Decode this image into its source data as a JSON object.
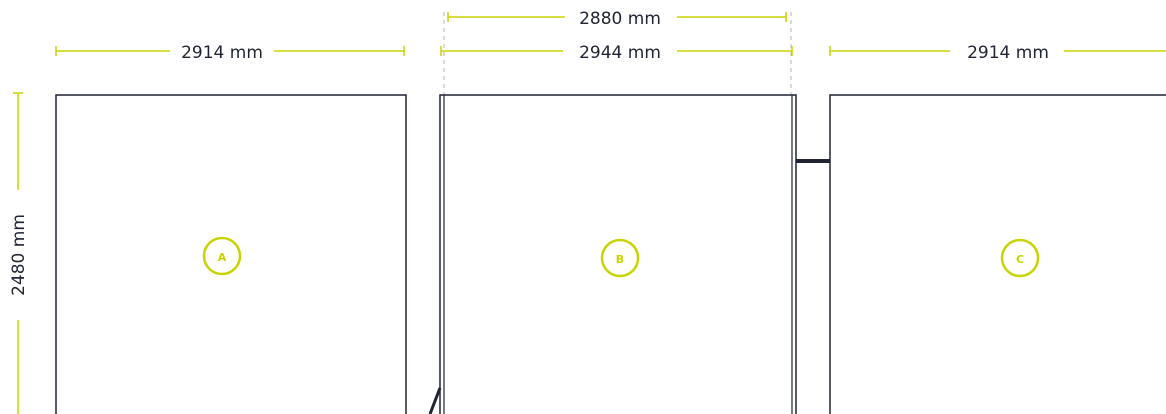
{
  "colors": {
    "dimension_line": "#c8d400",
    "panel_outline": "#1f2333",
    "guide_dash": "#b5b5b5",
    "badge": "#c8d400",
    "text": "#1f2333"
  },
  "dimensions": {
    "panel_a_width": "2914 mm",
    "panel_b_inner_width": "2880 mm",
    "panel_b_outer_width": "2944 mm",
    "panel_c_width": "2914 mm",
    "height": "2480 mm"
  },
  "panels": {
    "a": {
      "badge": "A"
    },
    "b": {
      "badge": "B"
    },
    "c": {
      "badge": "C"
    }
  }
}
